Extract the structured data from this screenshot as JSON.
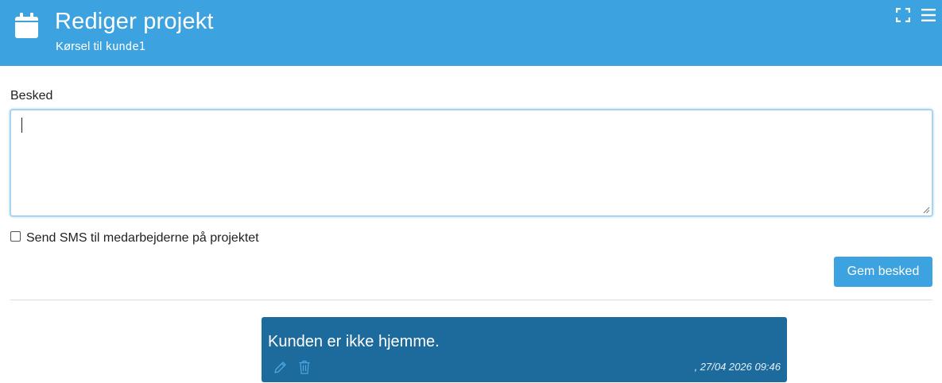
{
  "header": {
    "title": "Rediger projekt",
    "subtitle_prefix": "Kørsel til ",
    "subtitle_mono": "kunde1",
    "icons": {
      "left": "calendar-icon",
      "fullscreen": "fullscreen-icon",
      "menu": "hamburger-menu-icon"
    },
    "background": "#3da3e0"
  },
  "form": {
    "message_label": "Besked",
    "message_value": "",
    "sms_checked": false,
    "sms_label": "Send SMS til medarbejderne på projektet",
    "save_label": "Gem besked"
  },
  "messages": [
    {
      "text": "Kunden er ikke hjemme.",
      "meta": ", 27/04 2026 09:46",
      "icons": [
        "pencil-icon",
        "trash-icon"
      ],
      "background": "#1d6a9c"
    }
  ]
}
